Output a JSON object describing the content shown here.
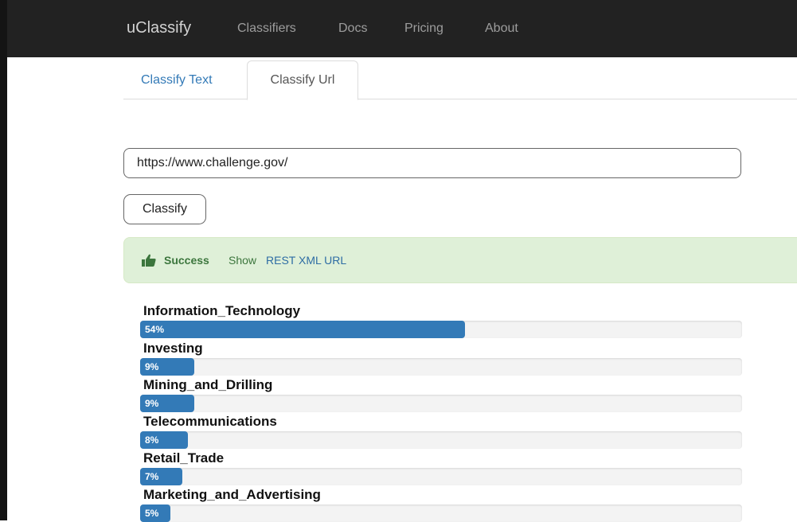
{
  "navbar": {
    "brand": "uClassify",
    "items": [
      "Classifiers",
      "Docs",
      "Pricing",
      "About"
    ]
  },
  "tabs": [
    {
      "label": "Classify Text",
      "active": false
    },
    {
      "label": "Classify Url",
      "active": true
    }
  ],
  "form": {
    "url_value": "https://www.challenge.gov/",
    "classify_label": "Classify"
  },
  "alert": {
    "icon": "thumbs-up-icon",
    "strong": "Success",
    "text": "Show",
    "link": "REST XML URL"
  },
  "results": [
    {
      "name": "Information_Technology",
      "percent_label": "54%",
      "percent": 54
    },
    {
      "name": "Investing",
      "percent_label": "9%",
      "percent": 9
    },
    {
      "name": "Mining_and_Drilling",
      "percent_label": "9%",
      "percent": 9
    },
    {
      "name": "Telecommunications",
      "percent_label": "8%",
      "percent": 8
    },
    {
      "name": "Retail_Trade",
      "percent_label": "7%",
      "percent": 7
    },
    {
      "name": "Marketing_and_Advertising",
      "percent_label": "5%",
      "percent": 5
    }
  ],
  "colors": {
    "navbar": "#222222",
    "accent": "#337ab7",
    "success_bg": "#dff0d8",
    "success_text": "#3c763d"
  }
}
